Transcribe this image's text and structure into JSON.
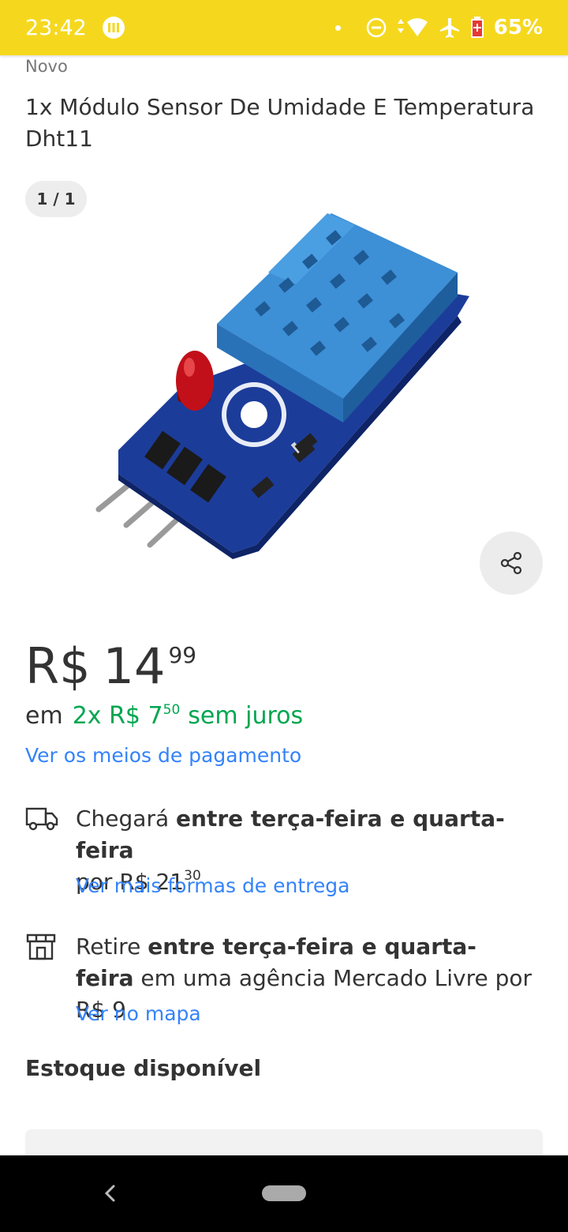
{
  "status_bar": {
    "time": "23:42",
    "battery": "65%",
    "icons": [
      "notification-dot",
      "do-not-disturb-icon",
      "wifi-icon",
      "airplane-icon",
      "battery-icon"
    ]
  },
  "product": {
    "condition": "Novo",
    "title": "1x Módulo Sensor De Umidade E Temperatura Dht11",
    "image_counter": "1 / 1",
    "price": {
      "currency": "R$",
      "integer": "14",
      "cents": "99"
    },
    "installments": {
      "prefix": "em",
      "count_label": "2x R$ 7",
      "cents": "50",
      "suffix": "sem juros"
    },
    "payment_link": "Ver os meios de pagamento"
  },
  "shipping": {
    "arrives_prefix": "Chegará",
    "arrives_bold": "entre terça-feira e quarta-feira",
    "arrives_price_prefix": "por R$ 21",
    "arrives_price_cents": "30",
    "more_options_link": "Ver mais formas de entrega"
  },
  "pickup": {
    "prefix": "Retire",
    "bold": "entre terça-feira e quarta-feira",
    "suffix": "em uma agência Mercado Livre por R$ 9",
    "map_link": "Ver no mapa"
  },
  "stock": {
    "label": "Estoque disponível"
  },
  "colors": {
    "brand_yellow": "#f5d81e",
    "link_blue": "#3483fa",
    "green": "#00a650"
  }
}
